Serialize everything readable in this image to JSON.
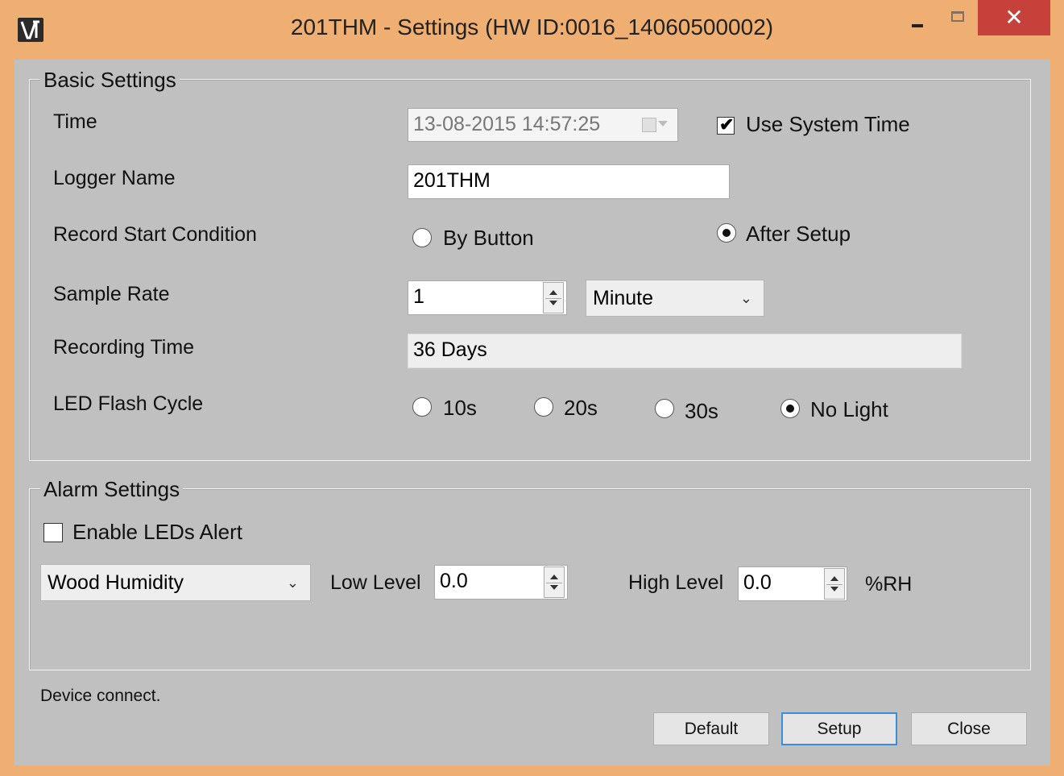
{
  "window": {
    "title": "201THM - Settings (HW ID:0016_14060500002)",
    "close_glyph": "✕"
  },
  "basic": {
    "group_title": "Basic Settings",
    "time_label": "Time",
    "time_value": "13-08-2015 14:57:25",
    "use_system_time_label": "Use System Time",
    "use_system_time_checked": true,
    "logger_name_label": "Logger Name",
    "logger_name_value": "201THM",
    "record_start_label": "Record Start Condition",
    "record_start_options": [
      "By Button",
      "After Setup"
    ],
    "record_start_selected": "After Setup",
    "sample_rate_label": "Sample Rate",
    "sample_rate_value": "1",
    "sample_rate_unit": "Minute",
    "recording_time_label": "Recording Time",
    "recording_time_value": "36 Days",
    "led_flash_label": "LED Flash Cycle",
    "led_options": [
      "10s",
      "20s",
      "30s",
      "No Light"
    ],
    "led_selected": "No Light"
  },
  "alarm": {
    "group_title": "Alarm Settings",
    "enable_leds_label": "Enable LEDs Alert",
    "enable_leds_checked": false,
    "sensor_selected": "Wood Humidity",
    "low_level_label": "Low Level",
    "low_level_value": "0.0",
    "high_level_label": "High Level",
    "high_level_value": "0.0",
    "unit": "%RH"
  },
  "status_text": "Device connect.",
  "buttons": {
    "default_label": "Default",
    "setup_label": "Setup",
    "close_label": "Close"
  },
  "colors": {
    "window_frame": "#efae72",
    "client_bg": "#c0c0c0",
    "close_button": "#c7413b",
    "focus_border": "#3c8fd6"
  },
  "icons": [
    "app-logo-icon",
    "minimize-icon",
    "maximize-icon",
    "close-icon",
    "calendar-icon",
    "chevron-down-icon",
    "spin-up-icon",
    "spin-down-icon"
  ]
}
